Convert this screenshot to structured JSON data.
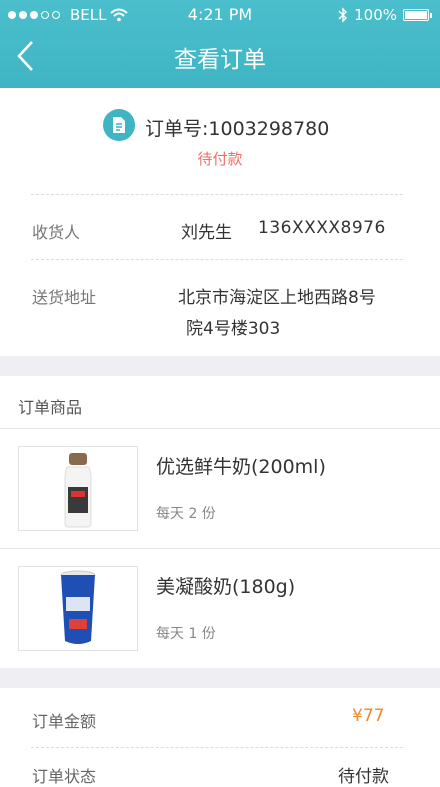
{
  "status_bar": {
    "carrier": "BELL",
    "time": "4:21 PM",
    "battery": "100%"
  },
  "nav": {
    "title": "查看订单"
  },
  "order": {
    "number": "订单号:1003298780",
    "status": "待付款"
  },
  "receiver": {
    "label": "收货人",
    "name": "刘先生",
    "phone": "136XXXX8976"
  },
  "address": {
    "label": "送货地址",
    "line1": "北京市海淀区上地西路8号",
    "line2": "院4号楼303"
  },
  "products": {
    "section_title": "订单商品",
    "items": [
      {
        "name": "优选鲜牛奶(200ml)",
        "qty": "每天 2 份"
      },
      {
        "name": "美凝酸奶(180g)",
        "qty": "每天 1 份"
      }
    ]
  },
  "summary": {
    "amount_label": "订单金额",
    "amount_value": "¥77",
    "next_label": "订单状态",
    "next_value": "待付款"
  },
  "colors": {
    "accent": "#3fb4c3",
    "status": "#ef6f63",
    "price": "#f08a2a"
  }
}
